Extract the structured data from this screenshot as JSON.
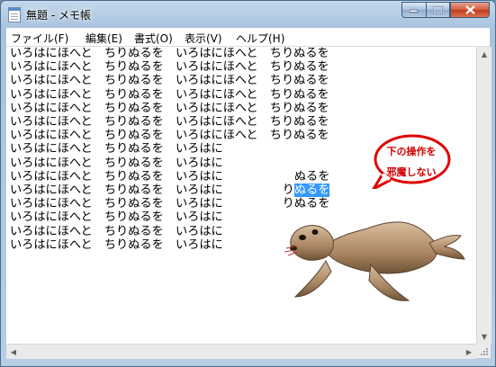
{
  "window": {
    "title": "無題 - メモ帳"
  },
  "menu": [
    "ファイル(F)",
    "編集(E)",
    "書式(O)",
    "表示(V)",
    "ヘルプ(H)"
  ],
  "editor": {
    "lines": [
      "いろはにほへと　ちりぬるを　いろはにほへと　ちりぬるを",
      "いろはにほへと　ちりぬるを　いろはにほへと　ちりぬるを",
      "いろはにほへと　ちりぬるを　いろはにほへと　ちりぬるを",
      "いろはにほへと　ちりぬるを　いろはにほへと　ちりぬるを",
      "いろはにほへと　ちりぬるを　いろはにほへと　ちりぬるを",
      "いろはにほへと　ちりぬるを　いろはにほへと　ちりぬるを",
      "いろはにほへと　ちりぬるを　いろはにほへと　ちりぬるを",
      "いろはにほへと　ちりぬるを　いろはに",
      "いろはにほへと　ちりぬるを　いろはに",
      "いろはにほへと　ちりぬるを　いろはに　　　　　　ぬるを",
      "いろはにほへと　ちりぬるを　いろはに　　　　　り",
      "いろはにほへと　ちりぬるを　いろはに　　　　　りぬるを",
      "いろはにほへと　ちりぬるを　いろはに",
      "いろはにほへと　ちりぬるを　いろはに",
      "いろはにほへと　ちりぬるを　いろはに"
    ],
    "selected_line_index": 10,
    "selected_text": "ぬるを"
  },
  "bubble": {
    "line1": "下の操作を",
    "line2": "邪魔しない"
  },
  "colors": {
    "selection": "#3399ff",
    "bubble_red": "#e00000",
    "seal_body": "#b08d6a"
  }
}
